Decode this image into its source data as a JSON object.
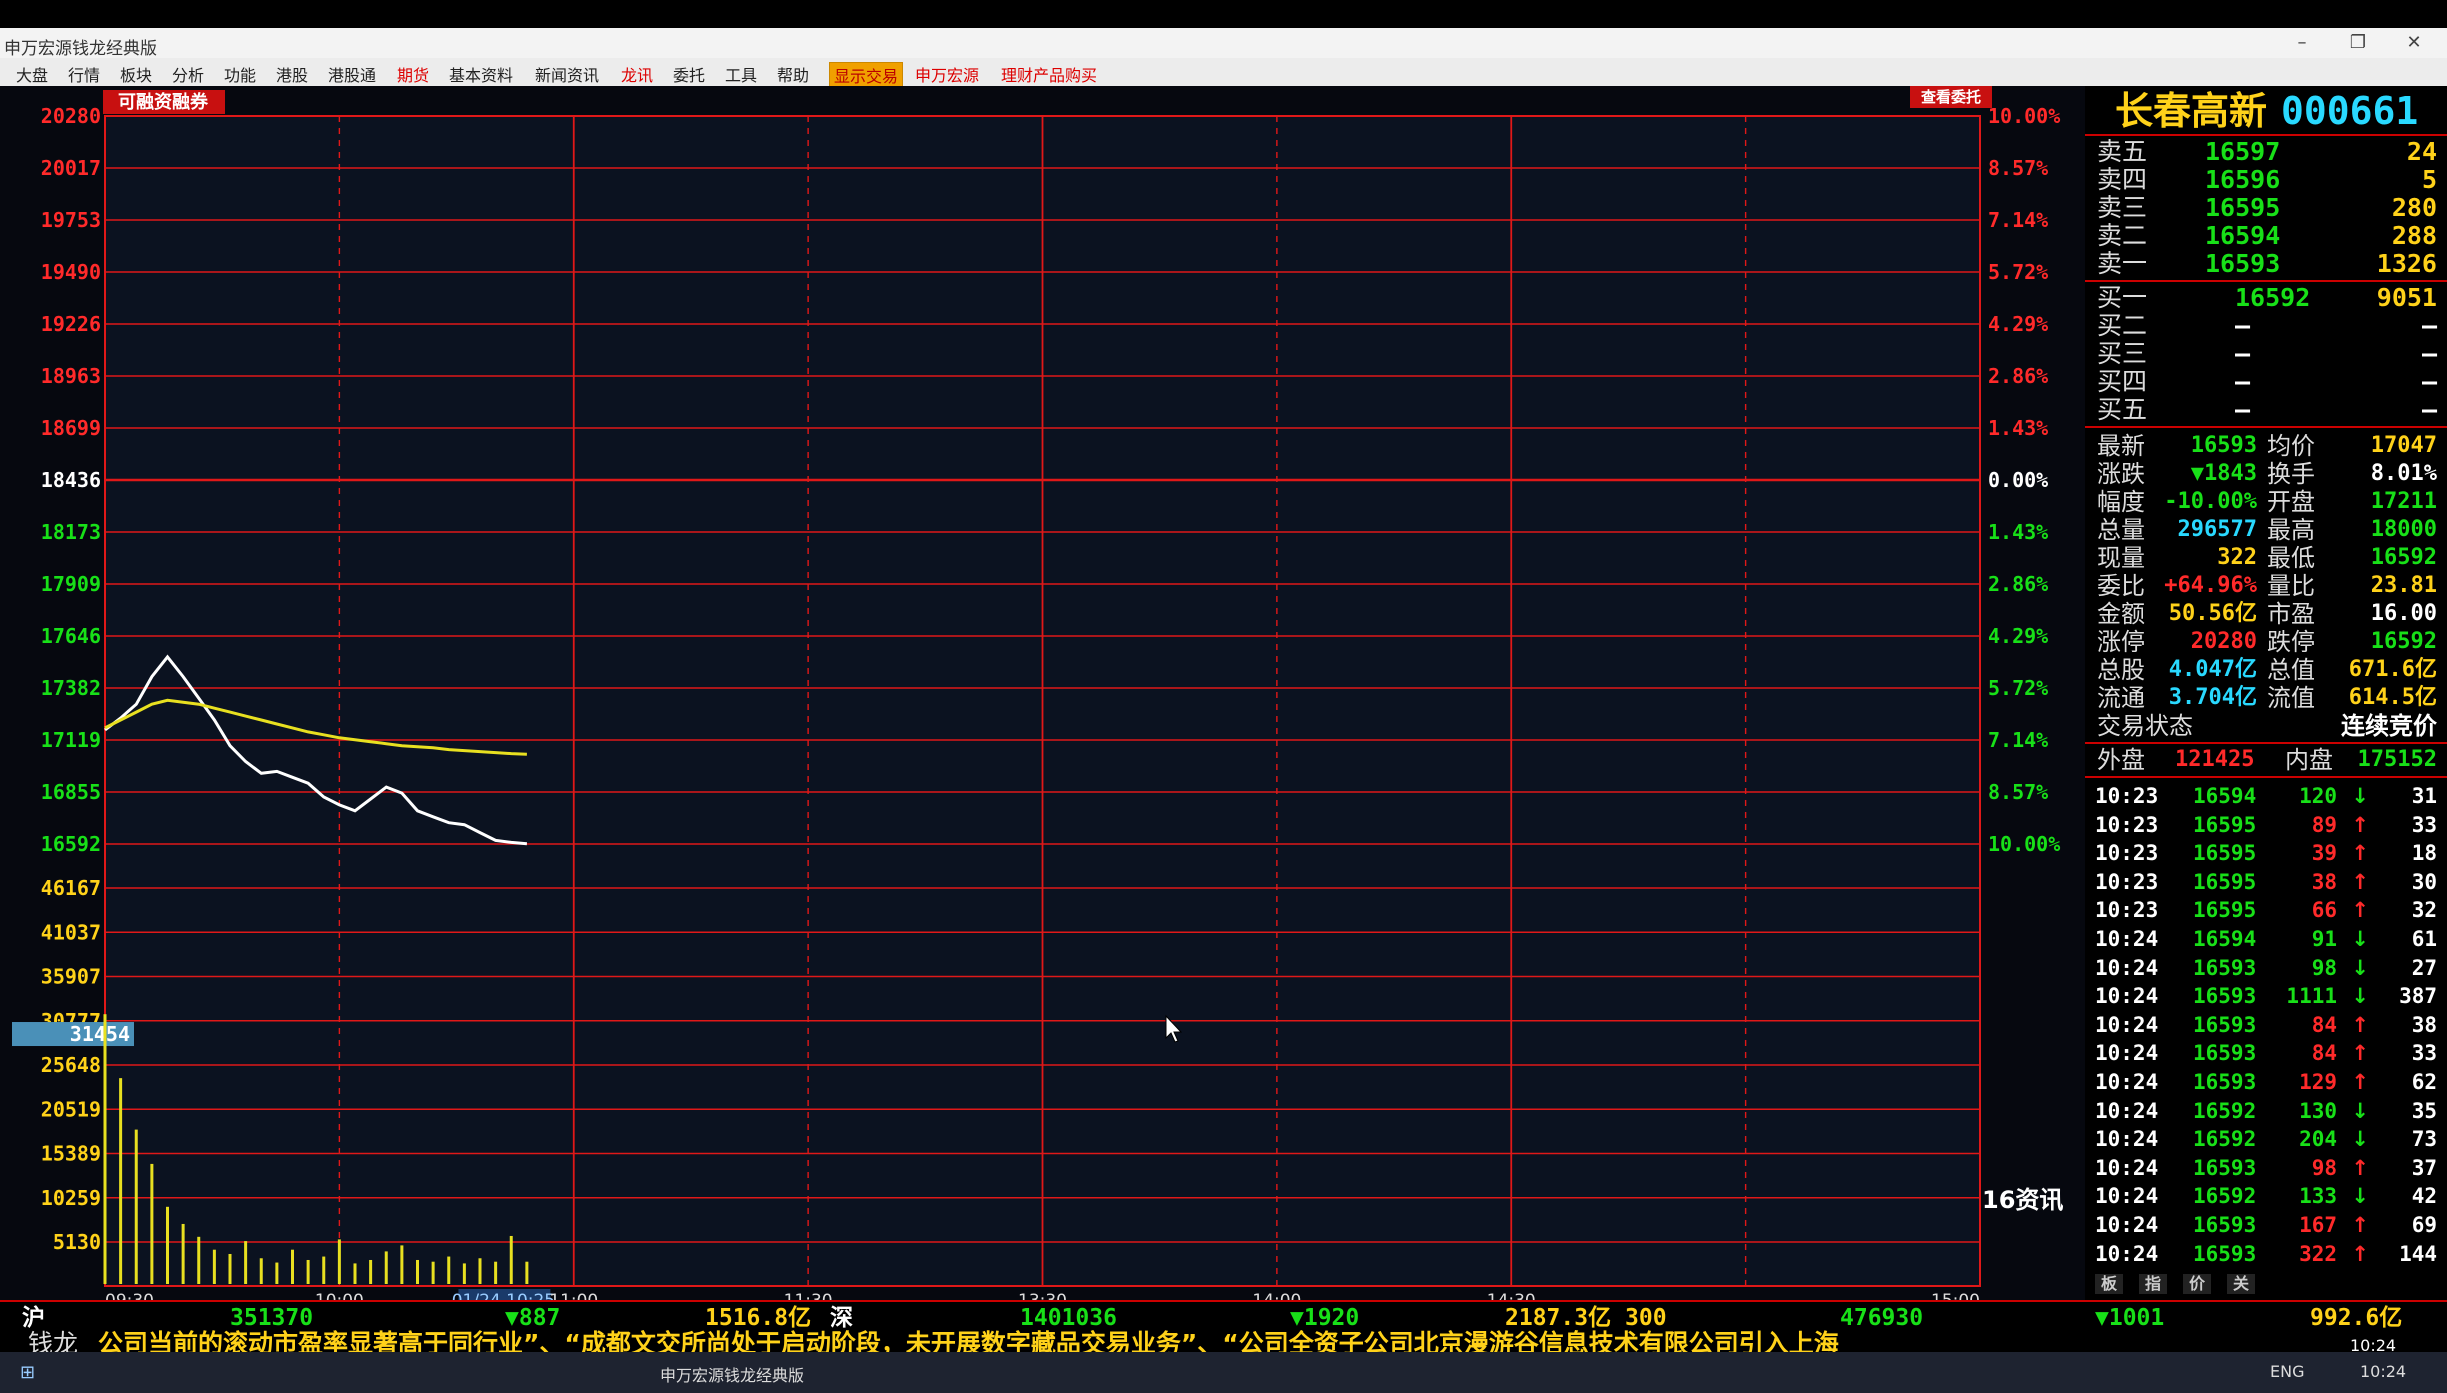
{
  "window": {
    "title": "申万宏源钱龙经典版"
  },
  "menu": [
    {
      "label": "大盘",
      "style": ""
    },
    {
      "label": "行情",
      "style": ""
    },
    {
      "label": "板块",
      "style": ""
    },
    {
      "label": "分析",
      "style": ""
    },
    {
      "label": "功能",
      "style": ""
    },
    {
      "label": "港股",
      "style": ""
    },
    {
      "label": "港股通",
      "style": ""
    },
    {
      "label": "期货",
      "style": "red"
    },
    {
      "label": "基本资料",
      "style": ""
    },
    {
      "label": "新闻资讯",
      "style": ""
    },
    {
      "label": "龙讯",
      "style": "red"
    },
    {
      "label": "委托",
      "style": ""
    },
    {
      "label": "工具",
      "style": ""
    },
    {
      "label": "帮助",
      "style": ""
    },
    {
      "label": "显示交易",
      "style": "hl"
    },
    {
      "label": "申万宏源",
      "style": "red"
    },
    {
      "label": "理财产品购买",
      "style": "red"
    }
  ],
  "chart": {
    "tag_left": "可融资融券",
    "tag_right": "查看委托",
    "price_axis": [
      "20280",
      "20017",
      "19753",
      "19490",
      "19226",
      "18963",
      "18699",
      "18436",
      "18173",
      "17909",
      "17646",
      "17382",
      "17119",
      "16855",
      "16592"
    ],
    "pct_axis": [
      "10.00%",
      "8.57%",
      "7.14%",
      "5.72%",
      "4.29%",
      "2.86%",
      "1.43%",
      "0.00%",
      "1.43%",
      "2.86%",
      "4.29%",
      "5.72%",
      "7.14%",
      "8.57%",
      "10.00%"
    ],
    "volume_axis": [
      "46167",
      "41037",
      "35907",
      "30777",
      "25648",
      "20519",
      "15389",
      "10259",
      "5130"
    ],
    "cursor_value": "31454",
    "time_axis": [
      "09:30",
      "10:00",
      "01/24 10:25",
      "11:00",
      "11:30",
      "13:30",
      "14:00",
      "14:30",
      "15:00"
    ],
    "news_label": "16资讯",
    "colors": {
      "grid": "#e01818",
      "price_line": "#ffffff",
      "avg_line": "#e8e020",
      "volume": "#e8e020"
    }
  },
  "chart_data": {
    "type": "line",
    "x": [
      "09:30",
      "09:32",
      "09:34",
      "09:36",
      "09:38",
      "09:40",
      "09:42",
      "09:44",
      "09:46",
      "09:48",
      "09:50",
      "09:52",
      "09:54",
      "09:56",
      "09:58",
      "10:00",
      "10:02",
      "10:04",
      "10:06",
      "10:08",
      "10:10",
      "10:12",
      "10:14",
      "10:16",
      "10:18",
      "10:20",
      "10:22",
      "10:24"
    ],
    "series": [
      {
        "values": [
          17170,
          17230,
          17300,
          17440,
          17540,
          17440,
          17330,
          17220,
          17090,
          17010,
          16950,
          16960,
          16930,
          16900,
          16830,
          16790,
          16760,
          16820,
          16880,
          16850,
          16760,
          16730,
          16700,
          16690,
          16650,
          16610,
          16600,
          16593
        ]
      },
      {
        "values": [
          17180,
          17220,
          17260,
          17300,
          17320,
          17310,
          17300,
          17280,
          17260,
          17240,
          17220,
          17200,
          17180,
          17160,
          17145,
          17130,
          17120,
          17110,
          17100,
          17090,
          17085,
          17080,
          17070,
          17065,
          17060,
          17055,
          17050,
          17047
        ]
      }
    ],
    "volume": [
      31454,
      24000,
      18000,
      14000,
      9000,
      7000,
      5500,
      4000,
      3500,
      5000,
      3000,
      2500,
      4000,
      2800,
      3200,
      5200,
      2400,
      2800,
      3800,
      4500,
      2800,
      2600,
      3200,
      2400,
      3000,
      2600,
      5600,
      2600
    ],
    "ylim": [
      16592,
      20280
    ],
    "volume_max": 46167,
    "title": "",
    "xlabel": "",
    "ylabel": ""
  },
  "panel": {
    "name": "长春高新",
    "code": "000661",
    "sell": [
      {
        "label": "卖五",
        "price": "16597",
        "vol": "24"
      },
      {
        "label": "卖四",
        "price": "16596",
        "vol": "5"
      },
      {
        "label": "卖三",
        "price": "16595",
        "vol": "280"
      },
      {
        "label": "卖二",
        "price": "16594",
        "vol": "288"
      },
      {
        "label": "卖一",
        "price": "16593",
        "vol": "1326"
      }
    ],
    "buy": [
      {
        "label": "买一",
        "price": "16592",
        "vol": "9051"
      },
      {
        "label": "买二",
        "price": "—",
        "vol": "—"
      },
      {
        "label": "买三",
        "price": "—",
        "vol": "—"
      },
      {
        "label": "买四",
        "price": "—",
        "vol": "—"
      },
      {
        "label": "买五",
        "price": "—",
        "vol": "—"
      }
    ],
    "stats": [
      {
        "l1": "最新",
        "v1": "16593",
        "c1": "green",
        "l2": "均价",
        "v2": "17047",
        "c2": "yellow"
      },
      {
        "l1": "涨跌",
        "v1": "▼1843",
        "c1": "green",
        "l2": "换手",
        "v2": "8.01%",
        "c2": "white"
      },
      {
        "l1": "幅度",
        "v1": "-10.00%",
        "c1": "green",
        "l2": "开盘",
        "v2": "17211",
        "c2": "green"
      },
      {
        "l1": "总量",
        "v1": "296577",
        "c1": "cyan",
        "l2": "最高",
        "v2": "18000",
        "c2": "green"
      },
      {
        "l1": "现量",
        "v1": "322",
        "c1": "yellow",
        "l2": "最低",
        "v2": "16592",
        "c2": "green"
      },
      {
        "l1": "委比",
        "v1": "+64.96%",
        "c1": "red",
        "l2": "量比",
        "v2": "23.81",
        "c2": "yellow"
      },
      {
        "l1": "金额",
        "v1": "50.56亿",
        "c1": "yellow",
        "l2": "市盈",
        "v2": "16.00",
        "c2": "white"
      },
      {
        "l1": "涨停",
        "v1": "20280",
        "c1": "red",
        "l2": "跌停",
        "v2": "16592",
        "c2": "green"
      },
      {
        "l1": "总股",
        "v1": "4.047亿",
        "c1": "cyan",
        "l2": "总值",
        "v2": "671.6亿",
        "c2": "yellow"
      },
      {
        "l1": "流通",
        "v1": "3.704亿",
        "c1": "cyan",
        "l2": "流值",
        "v2": "614.5亿",
        "c2": "yellow"
      }
    ],
    "trade_state_label": "交易状态",
    "trade_state": "连续竞价",
    "outer_label": "外盘",
    "outer": "121425",
    "inner_label": "内盘",
    "inner": "175152",
    "ticks": [
      {
        "t": "10:23",
        "p": "16594",
        "v": "120",
        "d": "↓",
        "n": "31",
        "vc": "green"
      },
      {
        "t": "10:23",
        "p": "16595",
        "v": "89",
        "d": "↑",
        "n": "33",
        "vc": "red"
      },
      {
        "t": "10:23",
        "p": "16595",
        "v": "39",
        "d": "↑",
        "n": "18",
        "vc": "red"
      },
      {
        "t": "10:23",
        "p": "16595",
        "v": "38",
        "d": "↑",
        "n": "30",
        "vc": "red"
      },
      {
        "t": "10:23",
        "p": "16595",
        "v": "66",
        "d": "↑",
        "n": "32",
        "vc": "red"
      },
      {
        "t": "10:24",
        "p": "16594",
        "v": "91",
        "d": "↓",
        "n": "61",
        "vc": "green"
      },
      {
        "t": "10:24",
        "p": "16593",
        "v": "98",
        "d": "↓",
        "n": "27",
        "vc": "green"
      },
      {
        "t": "10:24",
        "p": "16593",
        "v": "1111",
        "d": "↓",
        "n": "387",
        "vc": "green"
      },
      {
        "t": "10:24",
        "p": "16593",
        "v": "84",
        "d": "↑",
        "n": "38",
        "vc": "red"
      },
      {
        "t": "10:24",
        "p": "16593",
        "v": "84",
        "d": "↑",
        "n": "33",
        "vc": "red"
      },
      {
        "t": "10:24",
        "p": "16593",
        "v": "129",
        "d": "↑",
        "n": "62",
        "vc": "red"
      },
      {
        "t": "10:24",
        "p": "16592",
        "v": "130",
        "d": "↓",
        "n": "35",
        "vc": "green"
      },
      {
        "t": "10:24",
        "p": "16592",
        "v": "204",
        "d": "↓",
        "n": "73",
        "vc": "green"
      },
      {
        "t": "10:24",
        "p": "16593",
        "v": "98",
        "d": "↑",
        "n": "37",
        "vc": "red"
      },
      {
        "t": "10:24",
        "p": "16592",
        "v": "133",
        "d": "↓",
        "n": "42",
        "vc": "green"
      },
      {
        "t": "10:24",
        "p": "16593",
        "v": "167",
        "d": "↑",
        "n": "69",
        "vc": "red"
      },
      {
        "t": "10:24",
        "p": "16593",
        "v": "322",
        "d": "↑",
        "n": "144",
        "vc": "red"
      }
    ],
    "mini_tabs": [
      "板",
      "指",
      "价",
      "关"
    ]
  },
  "status": {
    "sh_label": "沪",
    "sh_index": "351370",
    "sh_change": "▼887",
    "sh_amount": "1516.8亿",
    "sz_label": "深",
    "sz_index": "1401036",
    "sz_change": "▼1920",
    "sz_amount": "2187.3亿",
    "idx300_label": "300",
    "idx300_value": "476930",
    "idx300_change": "▼1001",
    "idx300_amount": "992.6亿",
    "ticker_label": "钱龙",
    "ticker_text": "公司当前的滚动市盈率显著高于同行业”、“成都文交所尚处于启动阶段，未开展数字藏品交易业务”、“公司全资子公司北京漫游谷信息技术有限公司引入上海",
    "clock": "10:24"
  },
  "taskbar": {
    "app_label": "申万宏源钱龙经典版",
    "lang": "ENG",
    "time": "10:24"
  }
}
